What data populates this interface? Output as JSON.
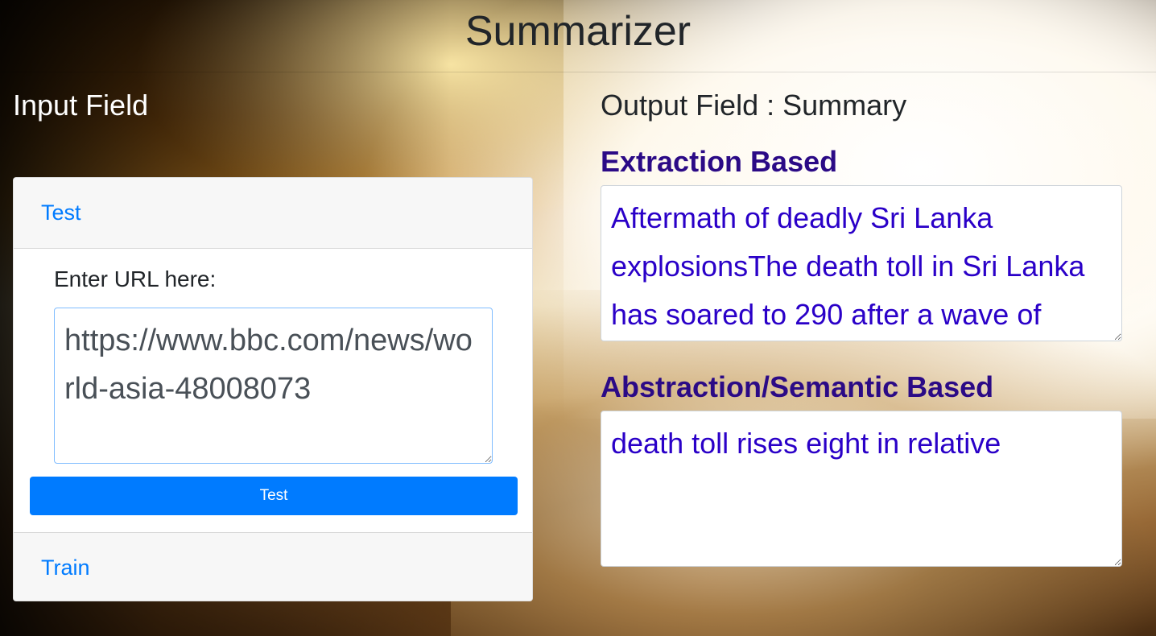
{
  "header": {
    "title": "Summarizer"
  },
  "input_section": {
    "heading": "Input Field",
    "accordion": {
      "test_tab_label": "Test",
      "url_label": "Enter URL here:",
      "url_value": "https://www.bbc.com/news/world-asia-48008073",
      "test_button_label": "Test",
      "train_tab_label": "Train"
    }
  },
  "output_section": {
    "heading": "Output Field : Summary",
    "extraction": {
      "label": "Extraction Based",
      "text": "Aftermath of deadly Sri Lanka explosionsThe death toll in Sri Lanka has soared to 290 after a wave of"
    },
    "abstraction": {
      "label": "Abstraction/Semantic Based",
      "text": "death toll rises eight in relative"
    }
  },
  "colors": {
    "link": "#007bff",
    "button": "#007bff",
    "section_label": "#2b0a86",
    "output_text": "#2a00c8"
  }
}
